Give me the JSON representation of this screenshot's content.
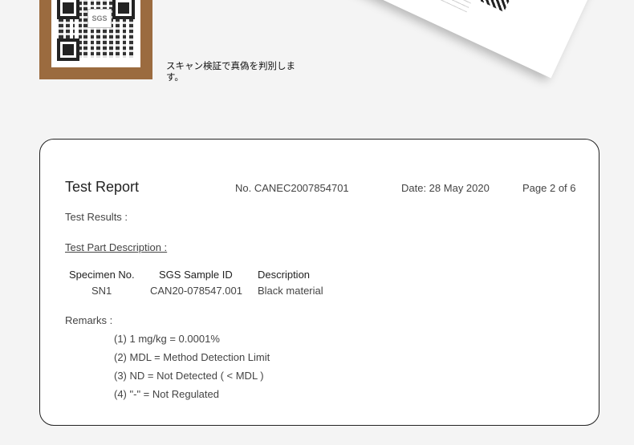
{
  "scan": {
    "qr_logo": "SGS",
    "caption": "スキャン検証で真偽を判別します。"
  },
  "report": {
    "title": "Test Report",
    "number": "No. CANEC2007854701",
    "date": "Date: 28 May 2020",
    "page": "Page 2 of 6",
    "results_label": "Test Results :",
    "part_description_label": "Test Part Description :",
    "table": {
      "headers": [
        "Specimen No.",
        "SGS Sample ID",
        "Description"
      ],
      "rows": [
        [
          "SN1",
          "CAN20-078547.001",
          "Black material"
        ]
      ]
    },
    "remarks_label": "Remarks :",
    "remarks": [
      "(1) 1 mg/kg = 0.0001%",
      "(2) MDL = Method Detection Limit",
      "(3) ND = Not Detected ( < MDL )",
      "(4) \"-\" = Not Regulated"
    ]
  },
  "colors": {
    "frame": "#9b6b3f",
    "background": "#f4f4f4"
  }
}
